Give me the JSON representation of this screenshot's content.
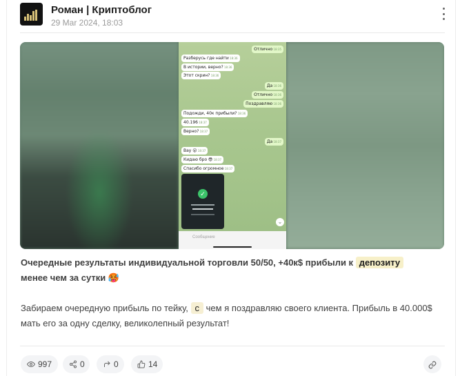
{
  "post": {
    "author": "Роман | Криптоблог",
    "date": "29 Мar 2024, 18:03",
    "title_part1": "Очередные результаты индивидуальной торговли 50/50, +40к$ прибыли к",
    "title_highlight": "депозиту",
    "title_part2": "менее чем за сутки",
    "title_emoji": "🥵",
    "body_part1": "Забираем очередную прибыль по тейку,",
    "body_highlight": "с",
    "body_part2": "чем я поздравляю своего клиента. Прибыль в 40.000$ мать его за одну сделку, великолепный результат!"
  },
  "chat": {
    "messages": [
      {
        "side": "out",
        "text": "Отлично",
        "time": "18:35"
      },
      {
        "side": "in",
        "text": "Разберусь где найти",
        "time": "18:36"
      },
      {
        "side": "in",
        "text": "В истории, верно?",
        "time": "18:36"
      },
      {
        "side": "in",
        "text": "Этот скрин?",
        "time": "18:36"
      },
      {
        "side": "out",
        "text": "Да",
        "time": "18:36"
      },
      {
        "side": "out",
        "text": "Отлично",
        "time": "18:36"
      },
      {
        "side": "out",
        "text": "Поздравляю",
        "time": "18:36"
      },
      {
        "side": "in",
        "text": "Подожди, 40к прибыли?",
        "time": "18:36"
      },
      {
        "side": "in",
        "text": "40.196",
        "time": "18:37"
      },
      {
        "side": "in",
        "text": "Верно?",
        "time": "18:37"
      },
      {
        "side": "out",
        "text": "Да",
        "time": "18:37"
      },
      {
        "side": "in",
        "text": "Вау 😮",
        "time": "18:37"
      },
      {
        "side": "in",
        "text": "Кидаю бро 😎",
        "time": "18:37"
      },
      {
        "side": "in",
        "text": "Спасибо огромное",
        "time": "18:37"
      }
    ],
    "composer_placeholder": "Сообщение"
  },
  "stats": {
    "views": "997",
    "reposts": "0",
    "shares": "0",
    "likes": "14"
  },
  "colors": {
    "highlight": "#f7f0c9",
    "chip_bg": "#f3f4f6",
    "chat_in": "#ffffff",
    "chat_out": "#e2f7c8",
    "chat_bg": "#a9c78f"
  }
}
